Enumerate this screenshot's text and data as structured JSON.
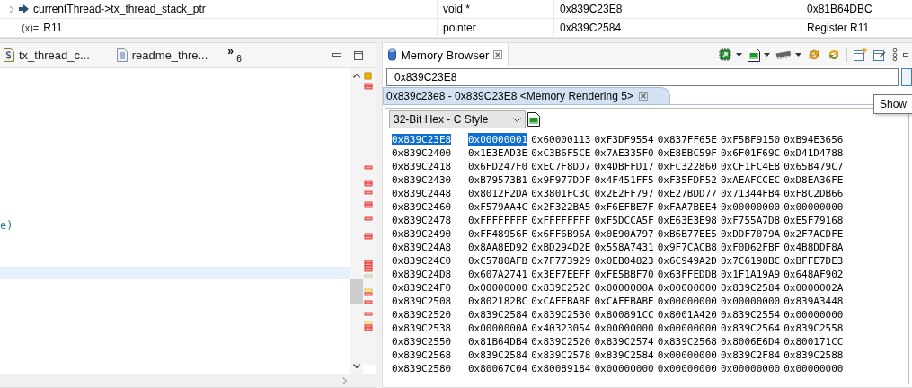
{
  "variables": {
    "rows": [
      {
        "kind": "pointer",
        "expression": "currentThread->tx_thread_stack_ptr",
        "type": "void *",
        "value": "0x839C23E8",
        "column_4": "0x81B64DBC"
      },
      {
        "kind": "register",
        "prefix": "(x)=",
        "expression": "R11",
        "type": "pointer",
        "value": "0x839C2584",
        "column_4": "Register R11"
      }
    ]
  },
  "editor": {
    "tabs": [
      {
        "label": "tx_thread_c...",
        "kind": "source",
        "selected": false
      },
      {
        "label": "readme_thre...",
        "kind": "text",
        "selected": false
      }
    ],
    "overflow": {
      "chevron": "»",
      "count": "6"
    },
    "code_fragment": "e)"
  },
  "memory_browser": {
    "tab": {
      "label": "Memory Browser",
      "selected": true
    },
    "address_field": {
      "value": "0x839C23E8"
    },
    "tooltip": "Show",
    "rendering_tab": {
      "label": "0x839c23e8 - 0x839C23E8 <Memory Rendering 5>",
      "selected": true
    },
    "format": "32-Bit Hex - C Style",
    "rows": [
      {
        "address": "0x839C23E8",
        "selected": true,
        "values": [
          "0x00000001",
          "0x60000113",
          "0xF3DF9554",
          "0x837FF65E",
          "0xF5BF9150",
          "0xB94E3656"
        ]
      },
      {
        "address": "0x839C2400",
        "selected": false,
        "values": [
          "0x1E3EAD3E",
          "0xC3B6F5CE",
          "0x7AE335F0",
          "0xE8EBC59F",
          "0x6F01F69C",
          "0xD41D4788"
        ]
      },
      {
        "address": "0x839C2418",
        "selected": false,
        "values": [
          "0x6FD247F0",
          "0xEC7F8DD7",
          "0x4DBFFD17",
          "0xFC322860",
          "0xCF1FC4E8",
          "0x65B479C7"
        ]
      },
      {
        "address": "0x839C2430",
        "selected": false,
        "values": [
          "0xB79573B1",
          "0x9F977DDF",
          "0x4F451FF5",
          "0xF35FDF52",
          "0xAEAFCCEC",
          "0xD8EA36FE"
        ]
      },
      {
        "address": "0x839C2448",
        "selected": false,
        "values": [
          "0x8012F2DA",
          "0x3801FC3C",
          "0x2E2FF797",
          "0xE27BDD77",
          "0x71344FB4",
          "0xF8C2DB66"
        ]
      },
      {
        "address": "0x839C2460",
        "selected": false,
        "values": [
          "0xF579AA4C",
          "0x2F322BA5",
          "0xF6EFBE7F",
          "0xFAA7BEE4",
          "0x00000000",
          "0x00000000"
        ]
      },
      {
        "address": "0x839C2478",
        "selected": false,
        "values": [
          "0xFFFFFFFF",
          "0xFFFFFFFF",
          "0xF5DCCA5F",
          "0xE63E3E98",
          "0xF755A7D8",
          "0xE5F79168"
        ]
      },
      {
        "address": "0x839C2490",
        "selected": false,
        "values": [
          "0xFF48956F",
          "0x6FF6B96A",
          "0x0E90A797",
          "0xB6B77EE5",
          "0xDDF7079A",
          "0x2F7ACDFE"
        ]
      },
      {
        "address": "0x839C24A8",
        "selected": false,
        "values": [
          "0x8AA8ED92",
          "0xBD294D2E",
          "0x558A7431",
          "0x9F7CACB8",
          "0xF0D62FBF",
          "0x4B8DDF8A"
        ]
      },
      {
        "address": "0x839C24C0",
        "selected": false,
        "values": [
          "0xC5780AFB",
          "0x7F773929",
          "0x0EB04823",
          "0x6C949A2D",
          "0x7C6198BC",
          "0xBFFE7DE3"
        ]
      },
      {
        "address": "0x839C24D8",
        "selected": false,
        "values": [
          "0x607A2741",
          "0x3EF7EEFF",
          "0xFE5BBF70",
          "0x63FFEDDB",
          "0x1F1A19A9",
          "0x648AF902"
        ]
      },
      {
        "address": "0x839C24F0",
        "selected": false,
        "values": [
          "0x00000000",
          "0x839C252C",
          "0x0000000A",
          "0x00000000",
          "0x839C2584",
          "0x0000002A"
        ]
      },
      {
        "address": "0x839C2508",
        "selected": false,
        "values": [
          "0x802182BC",
          "0xCAFEBABE",
          "0xCAFEBABE",
          "0x00000000",
          "0x00000000",
          "0x839A3448"
        ]
      },
      {
        "address": "0x839C2520",
        "selected": false,
        "values": [
          "0x839C2584",
          "0x839C2530",
          "0x800891CC",
          "0x8001A420",
          "0x839C2554",
          "0x00000000"
        ]
      },
      {
        "address": "0x839C2538",
        "selected": false,
        "values": [
          "0x0000000A",
          "0x40323054",
          "0x00000000",
          "0x00000000",
          "0x839C2564",
          "0x839C2558"
        ]
      },
      {
        "address": "0x839C2550",
        "selected": false,
        "values": [
          "0x81B64DB4",
          "0x839C2520",
          "0x839C2574",
          "0x839C2568",
          "0x8006E6D4",
          "0x800171CC"
        ]
      },
      {
        "address": "0x839C2568",
        "selected": false,
        "values": [
          "0x839C2584",
          "0x839C2578",
          "0x839C2584",
          "0x00000000",
          "0x839C2F84",
          "0x839C2588"
        ]
      },
      {
        "address": "0x839C2580",
        "selected": false,
        "values": [
          "0x80067C04",
          "0x80089184",
          "0x00000000",
          "0x00000000",
          "0x00000000",
          "0x00000000"
        ]
      }
    ]
  }
}
